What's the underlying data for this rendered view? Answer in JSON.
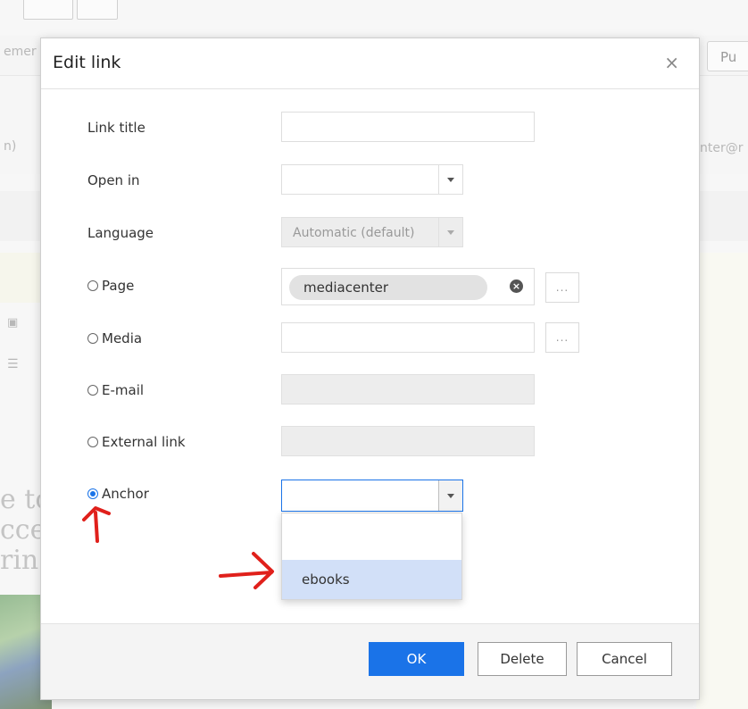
{
  "background": {
    "left_snippet": "emer",
    "left_dropdown": "n)",
    "right_email_fragment": "nter@r",
    "publish_fragment": "Pu",
    "serif_lines": [
      "e to",
      "cce",
      "rin"
    ]
  },
  "dialog": {
    "title": "Edit link",
    "close_glyph": "×",
    "fields": {
      "link_title": {
        "label": "Link title",
        "value": ""
      },
      "open_in": {
        "label": "Open in",
        "value": ""
      },
      "language": {
        "label": "Language",
        "value": "Automatic (default)"
      },
      "page": {
        "label": "Page",
        "value": "mediacenter",
        "clear_glyph": "×",
        "browse_label": "..."
      },
      "media": {
        "label": "Media",
        "value": "",
        "browse_label": "..."
      },
      "email": {
        "label": "E-mail",
        "value": ""
      },
      "external_link": {
        "label": "External link",
        "value": ""
      },
      "anchor": {
        "label": "Anchor",
        "value": "",
        "selected": true
      }
    },
    "anchor_options": [
      "",
      "ebooks"
    ],
    "buttons": {
      "ok": "OK",
      "delete": "Delete",
      "cancel": "Cancel"
    }
  },
  "colors": {
    "primary": "#1a73e8",
    "highlight": "#d2e0f8",
    "annotation": "#e0201b"
  }
}
